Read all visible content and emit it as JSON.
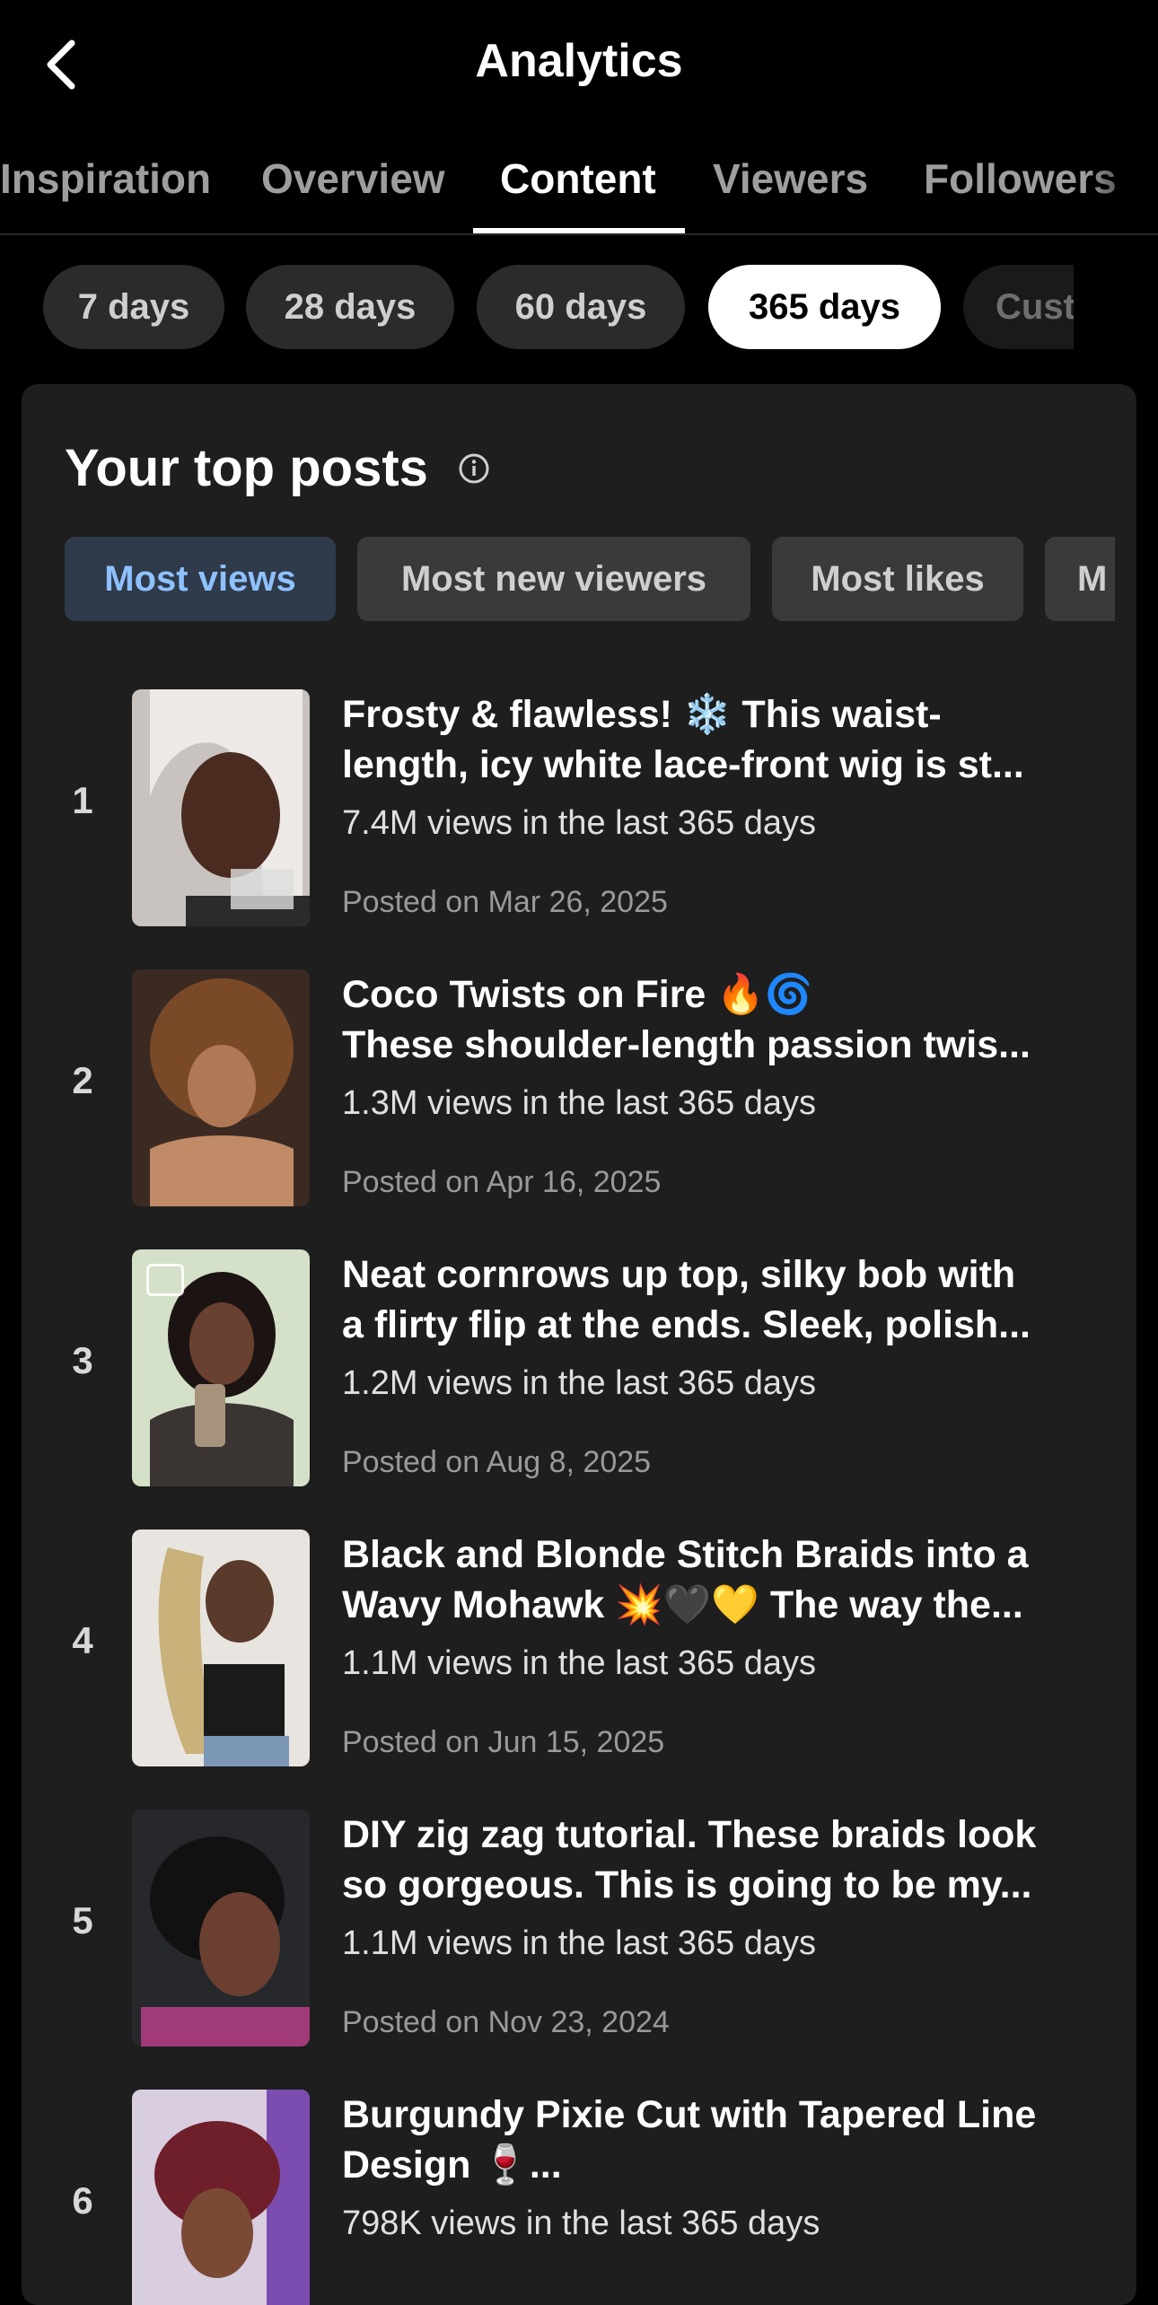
{
  "header": {
    "title": "Analytics"
  },
  "tabs": [
    {
      "label": "Inspiration",
      "active": false
    },
    {
      "label": "Overview",
      "active": false
    },
    {
      "label": "Content",
      "active": true
    },
    {
      "label": "Viewers",
      "active": false
    },
    {
      "label": "Followers",
      "active": false
    }
  ],
  "ranges": [
    {
      "label": "7 days",
      "active": false
    },
    {
      "label": "28 days",
      "active": false
    },
    {
      "label": "60 days",
      "active": false
    },
    {
      "label": "365 days",
      "active": true
    },
    {
      "label": "Custom",
      "active": false
    }
  ],
  "panel": {
    "title": "Your top posts",
    "filters": [
      {
        "label": "Most views",
        "active": true
      },
      {
        "label": "Most new viewers",
        "active": false
      },
      {
        "label": "Most likes",
        "active": false
      },
      {
        "label": "M",
        "active": false
      }
    ]
  },
  "posts": [
    {
      "rank": "1",
      "title_line1": "Frosty & flawless! ❄️ This waist-",
      "title_line2": "length, icy white lace-front wig is st...",
      "views": "7.4M views in the last 365 days",
      "posted": "Posted on Mar 26, 2025"
    },
    {
      "rank": "2",
      "title_line1": "Coco Twists on Fire 🔥🌀",
      "title_line2": "These shoulder-length passion twis...",
      "views": "1.3M views in the last 365 days",
      "posted": "Posted on Apr 16, 2025"
    },
    {
      "rank": "3",
      "title_line1": "Neat cornrows up top, silky bob with",
      "title_line2": "a flirty flip at the ends. Sleek, polish...",
      "views": "1.2M views in the last 365 days",
      "posted": "Posted on Aug 8, 2025"
    },
    {
      "rank": "4",
      "title_line1": "Black and Blonde Stitch Braids into a",
      "title_line2": "Wavy Mohawk 💥🖤💛 The way the...",
      "views": "1.1M views in the last 365 days",
      "posted": "Posted on Jun 15, 2025"
    },
    {
      "rank": "5",
      "title_line1": "DIY zig zag tutorial. These braids look",
      "title_line2": "so gorgeous. This is going to be my...",
      "views": "1.1M views in the last 365 days",
      "posted": "Posted on Nov 23, 2024"
    },
    {
      "rank": "6",
      "title_line1": "Burgundy Pixie Cut with Tapered Line",
      "title_line2": "Design 🍷...",
      "views": "798K views in the last 365 days",
      "posted": ""
    }
  ],
  "colors": {
    "background": "#000000",
    "panel": "#1e1e1e",
    "accent_filter": "#8ec1ff"
  }
}
